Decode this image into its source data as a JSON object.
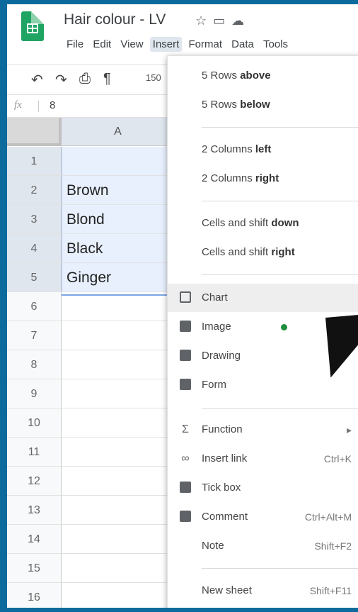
{
  "header": {
    "doc_title": "Hair colour - LV",
    "title_icons": [
      "star-icon",
      "folder-icon",
      "cloud-icon"
    ]
  },
  "menubar": {
    "items": [
      "File",
      "Edit",
      "View",
      "Insert",
      "Format",
      "Data",
      "Tools"
    ],
    "active": "Insert"
  },
  "toolbar": {
    "zoom": "150"
  },
  "formula_bar": {
    "fx": "fx",
    "value": "8"
  },
  "sheet": {
    "column_header": "A",
    "rows": [
      {
        "num": "1",
        "value": ""
      },
      {
        "num": "2",
        "value": "Brown"
      },
      {
        "num": "3",
        "value": "Blond"
      },
      {
        "num": "4",
        "value": "Black"
      },
      {
        "num": "5",
        "value": "Ginger"
      },
      {
        "num": "6",
        "value": ""
      },
      {
        "num": "7",
        "value": ""
      },
      {
        "num": "8",
        "value": ""
      },
      {
        "num": "9",
        "value": ""
      },
      {
        "num": "10",
        "value": ""
      },
      {
        "num": "11",
        "value": ""
      },
      {
        "num": "12",
        "value": ""
      },
      {
        "num": "13",
        "value": ""
      },
      {
        "num": "14",
        "value": ""
      },
      {
        "num": "15",
        "value": ""
      },
      {
        "num": "16",
        "value": ""
      }
    ]
  },
  "insert_menu": {
    "rows_above": {
      "prefix": "5 Rows ",
      "bold": "above"
    },
    "rows_below": {
      "prefix": "5 Rows ",
      "bold": "below"
    },
    "cols_left": {
      "prefix": "2 Columns ",
      "bold": "left"
    },
    "cols_right": {
      "prefix": "2 Columns ",
      "bold": "right"
    },
    "cells_down": {
      "prefix": "Cells and shift ",
      "bold": "down"
    },
    "cells_right": {
      "prefix": "Cells and shift ",
      "bold": "right"
    },
    "chart": "Chart",
    "image": "Image",
    "drawing": "Drawing",
    "form": "Form",
    "function": "Function",
    "insert_link": "Insert link",
    "insert_link_shortcut": "Ctrl+K",
    "tick_box": "Tick box",
    "comment": "Comment",
    "comment_shortcut": "Ctrl+Alt+M",
    "note": "Note",
    "note_shortcut": "Shift+F2",
    "new_sheet": "New sheet",
    "new_sheet_shortcut": "Shift+F11",
    "accent_color": "#1e8e3e"
  }
}
